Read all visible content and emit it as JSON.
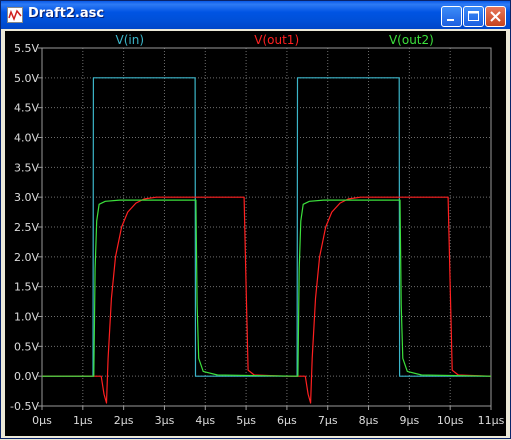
{
  "window": {
    "title": "Draft2.asc"
  },
  "chart_data": {
    "type": "line",
    "xlabel": "",
    "ylabel": "",
    "xlim": [
      0,
      11
    ],
    "ylim": [
      -0.5,
      5.5
    ],
    "x_unit": "µs",
    "y_unit": "V",
    "grid": true,
    "legend_placement": "top",
    "x_ticks": [
      "0µs",
      "1µs",
      "2µs",
      "3µs",
      "4µs",
      "5µs",
      "6µs",
      "7µs",
      "8µs",
      "9µs",
      "10µs",
      "11µs"
    ],
    "y_ticks": [
      "-0.5V",
      "0.0V",
      "0.5V",
      "1.0V",
      "1.5V",
      "2.0V",
      "2.5V",
      "3.0V",
      "3.5V",
      "4.0V",
      "4.5V",
      "5.0V",
      "5.5V"
    ],
    "series": [
      {
        "name": "V(in)",
        "color": "#3cb6c9",
        "points": [
          [
            0,
            0
          ],
          [
            1.25,
            0
          ],
          [
            1.26,
            5.0
          ],
          [
            3.75,
            5.0
          ],
          [
            3.76,
            0
          ],
          [
            6.25,
            0
          ],
          [
            6.26,
            5.0
          ],
          [
            8.75,
            5.0
          ],
          [
            8.76,
            0
          ],
          [
            11,
            0
          ]
        ]
      },
      {
        "name": "V(out1)",
        "color": "#ff2020",
        "points": [
          [
            0,
            0
          ],
          [
            1.45,
            0
          ],
          [
            1.52,
            -0.3
          ],
          [
            1.58,
            -0.45
          ],
          [
            1.62,
            0.3
          ],
          [
            1.7,
            1.3
          ],
          [
            1.8,
            2.0
          ],
          [
            1.95,
            2.5
          ],
          [
            2.1,
            2.75
          ],
          [
            2.3,
            2.9
          ],
          [
            2.5,
            2.97
          ],
          [
            2.8,
            3.0
          ],
          [
            4.95,
            3.0
          ],
          [
            5.0,
            1.5
          ],
          [
            5.05,
            0.1
          ],
          [
            5.2,
            0.02
          ],
          [
            6.0,
            0
          ],
          [
            6.45,
            0
          ],
          [
            6.52,
            -0.3
          ],
          [
            6.58,
            -0.45
          ],
          [
            6.62,
            0.3
          ],
          [
            6.7,
            1.3
          ],
          [
            6.8,
            2.0
          ],
          [
            6.95,
            2.5
          ],
          [
            7.1,
            2.75
          ],
          [
            7.3,
            2.9
          ],
          [
            7.5,
            2.97
          ],
          [
            7.8,
            3.0
          ],
          [
            9.95,
            3.0
          ],
          [
            10.0,
            1.5
          ],
          [
            10.05,
            0.1
          ],
          [
            10.2,
            0.02
          ],
          [
            11,
            0
          ]
        ]
      },
      {
        "name": "V(out2)",
        "color": "#3ce03c",
        "points": [
          [
            0,
            0
          ],
          [
            1.27,
            0
          ],
          [
            1.3,
            1.8
          ],
          [
            1.34,
            2.6
          ],
          [
            1.4,
            2.88
          ],
          [
            1.55,
            2.93
          ],
          [
            1.9,
            2.95
          ],
          [
            3.77,
            2.95
          ],
          [
            3.8,
            1.2
          ],
          [
            3.84,
            0.3
          ],
          [
            3.95,
            0.08
          ],
          [
            4.3,
            0.02
          ],
          [
            6.27,
            0
          ],
          [
            6.3,
            1.8
          ],
          [
            6.34,
            2.6
          ],
          [
            6.4,
            2.88
          ],
          [
            6.55,
            2.93
          ],
          [
            6.9,
            2.95
          ],
          [
            8.77,
            2.95
          ],
          [
            8.8,
            1.2
          ],
          [
            8.84,
            0.3
          ],
          [
            8.95,
            0.08
          ],
          [
            9.3,
            0.02
          ],
          [
            11,
            0
          ]
        ]
      }
    ]
  }
}
